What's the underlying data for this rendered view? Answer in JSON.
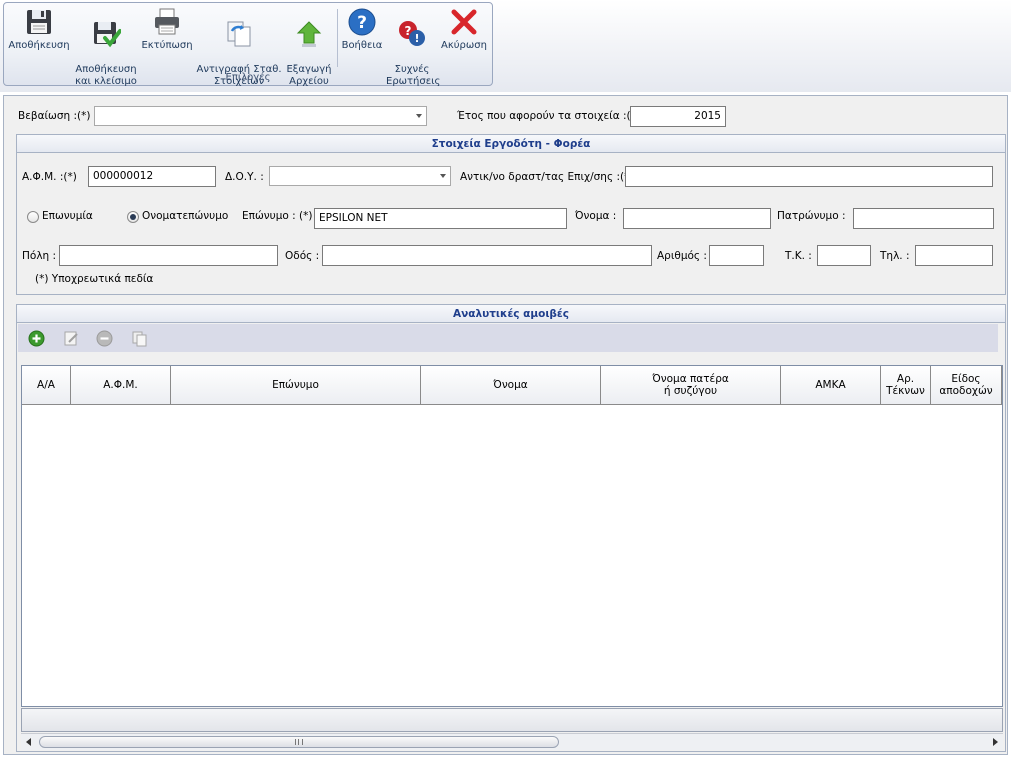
{
  "ribbon": {
    "buttons": [
      {
        "label": "Αποθήκευση",
        "icon": "floppy-save-icon"
      },
      {
        "label": "Αποθήκευση\nκαι κλείσιμο",
        "icon": "floppy-save-close-icon"
      },
      {
        "label": "Εκτύπωση",
        "icon": "printer-icon"
      },
      {
        "label": "Αντιγραφή Σταθ.\nΣτοιχείων",
        "icon": "copy-document-icon"
      },
      {
        "label": "Εξαγωγή\nΑρχείου",
        "icon": "export-arrow-icon"
      },
      {
        "label": "Βοήθεια",
        "icon": "help-icon"
      },
      {
        "label": "Συχνές\nΕρωτήσεις",
        "icon": "faq-icon"
      },
      {
        "label": "Ακύρωση",
        "icon": "cancel-x-icon"
      }
    ],
    "group_label": "Επιλογές"
  },
  "form": {
    "certificate_label": "Βεβαίωση :(*)",
    "certificate_value": "",
    "year_label": "Έτος που αφορούν τα στοιχεία :(*)",
    "year_value": "2015"
  },
  "employer": {
    "title": "Στοιχεία Εργοδότη - Φορέα",
    "afm_label": "Α.Φ.Μ. :(*)",
    "afm_value": "000000012",
    "doy_label": "Δ.Ο.Υ. :",
    "doy_value": "",
    "rep_label": "Αντικ/νο δραστ/τας Επιχ/σης :(*)",
    "rep_value": "",
    "radio_company": "Επωνυμία",
    "radio_person": "Ονοματεπώνυμο",
    "surname_label": "Επώνυμο : (*)",
    "surname_value": "EPSILON NET",
    "name_label": "Όνομα :",
    "name_value": "",
    "father_label": "Πατρώνυμο :",
    "father_value": "",
    "city_label": "Πόλη :",
    "city_value": "",
    "street_label": "Οδός :",
    "street_value": "",
    "number_label": "Αριθμός :",
    "number_value": "",
    "zip_label": "Τ.Κ. :",
    "zip_value": "",
    "phone_label": "Τηλ. :",
    "phone_value": "",
    "required_note": "(*) Υποχρεωτικά πεδία"
  },
  "earnings": {
    "title": "Αναλυτικές αμοιβές",
    "toolbar_icons": [
      "add-icon",
      "edit-icon",
      "remove-icon",
      "copy-icon"
    ],
    "columns": [
      "Α/Α",
      "Α.Φ.Μ.",
      "Επώνυμο",
      "Όνομα",
      "Όνομα πατέρα\nή συζύγου",
      "ΑΜΚΑ",
      "Αρ.\nΤέκνων",
      "Είδος\nαποδοχών"
    ],
    "rows": []
  },
  "colors": {
    "section_title": "#1f3e8c",
    "panel_bg": "#f0f0f0",
    "ribbon_text": "#1e395b"
  }
}
